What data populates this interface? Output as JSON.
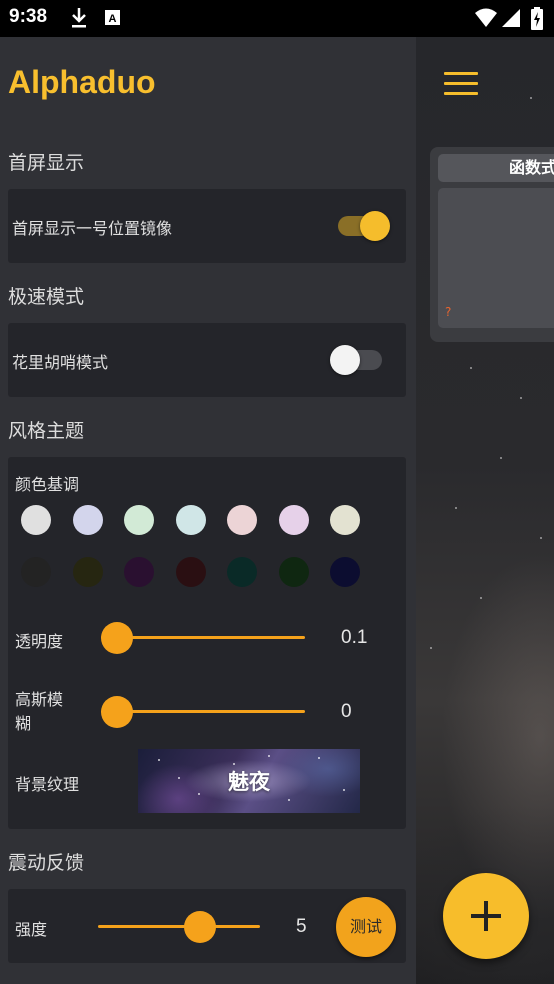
{
  "status_bar": {
    "time": "9:38",
    "icons": [
      "download-icon",
      "a-badge-icon",
      "wifi-icon",
      "signal-icon",
      "battery-charging-icon"
    ]
  },
  "background_app": {
    "function_tab_label": "函数式",
    "placeholder_mark": "?",
    "fab_icon": "plus-icon",
    "menu_icon": "hamburger-menu-icon"
  },
  "drawer": {
    "app_title": "Alphaduo",
    "sections": {
      "home": {
        "title": "首屏显示",
        "mirror_label": "首屏显示一号位置镜像",
        "mirror_enabled": true
      },
      "speed": {
        "title": "极速模式",
        "fancy_label": "花里胡哨模式",
        "fancy_enabled": false
      },
      "theme": {
        "title": "风格主题",
        "color_label": "颜色基调",
        "light_colors": [
          "#e0e0e0",
          "#d3d5ec",
          "#d2ead6",
          "#d0e6e7",
          "#ecd4d6",
          "#e6d1e9",
          "#e3e2d1"
        ],
        "dark_colors": [
          "#232323",
          "#262611",
          "#2a1030",
          "#2a0f12",
          "#0a2a27",
          "#0f2711",
          "#0c0d30"
        ],
        "opacity_label": "透明度",
        "opacity_value": "0.1",
        "opacity_fraction": 0.0,
        "blur_label_line1": "高斯模",
        "blur_label_line2": "糊",
        "blur_value": "0",
        "blur_fraction": 0.0,
        "texture_label": "背景纹理",
        "texture_name": "魅夜"
      },
      "haptics": {
        "title": "震动反馈",
        "strength_label": "强度",
        "strength_value": "5",
        "strength_fraction": 0.66,
        "test_label": "测试"
      }
    }
  },
  "colors": {
    "accent": "#f8bf2e",
    "slider": "#f5a21b",
    "drawer_bg": "#303136",
    "card_bg": "#24252a"
  }
}
